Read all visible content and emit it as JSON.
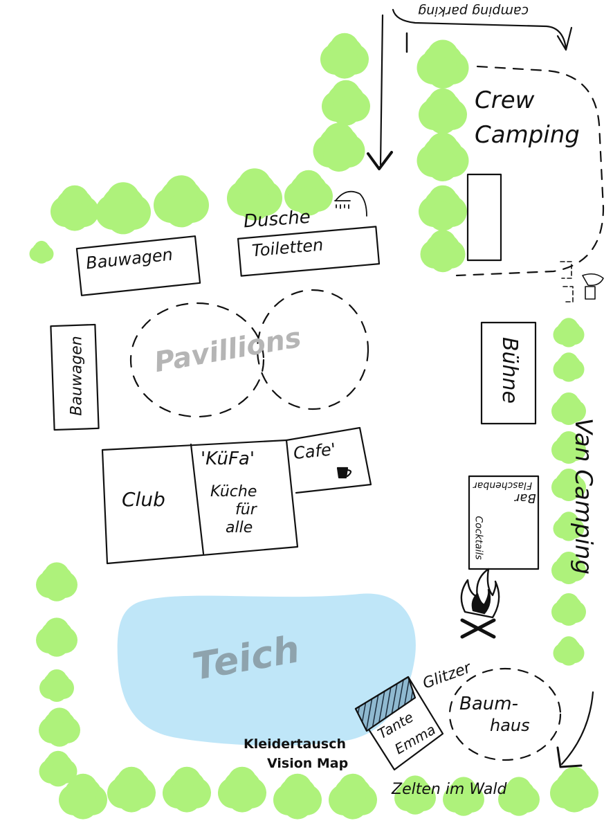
{
  "labels": {
    "camping_parking": "camping parking",
    "crew": "Crew",
    "camping": "Camping",
    "dusche": "Dusche",
    "toiletten": "Toiletten",
    "bauwagen_top": "Bauwagen",
    "bauwagen_side": "Bauwagen",
    "pavillions": "Pavillions",
    "buehne": "Bühne",
    "club": "Club",
    "kufa": "'KüFa'",
    "kueche": "Küche",
    "fuer": "für",
    "alle": "alle",
    "cafe": "Cafe'",
    "bar": "Bar",
    "flaschenbar": "Flaschenbar",
    "cocktails": "Cocktails",
    "van_camping": "Van Camping",
    "teich": "Teich",
    "glitzer": "Glitzer",
    "baumhaus_1": "Baum-",
    "baumhaus_2": "haus",
    "tante": "Tante",
    "emma": "Emma",
    "kleidertausch": "Kleidertausch",
    "vision_map": "Vision Map",
    "zelten_im_wald": "Zelten im Wald"
  },
  "colors": {
    "tree": "#aef27b",
    "pond": "#bfe6f8",
    "ink": "#111111",
    "label_grey": "#b5b5b5",
    "pond_label": "#8ea3ad"
  },
  "icons": [
    "shower-icon",
    "coffee-cup-icon",
    "campfire-icon",
    "toilet-icon",
    "tree-icon"
  ]
}
